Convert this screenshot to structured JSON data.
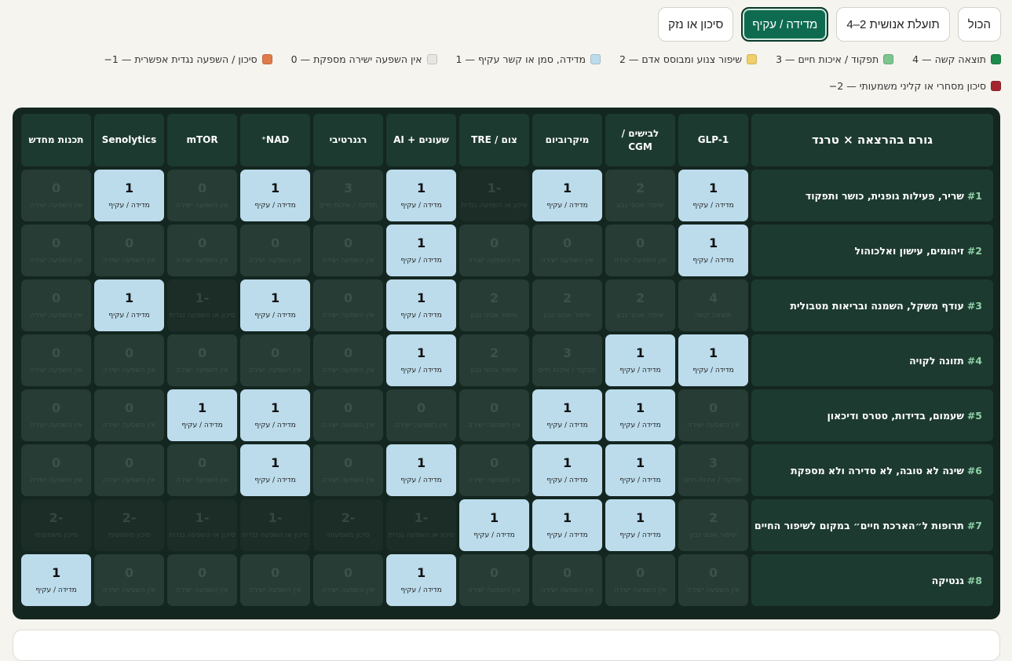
{
  "filters": [
    {
      "label": "הכול",
      "active": false
    },
    {
      "label": "תועלת אנושית 2–4",
      "active": false
    },
    {
      "label": "מדידה / עקיף",
      "active": true
    },
    {
      "label": "סיכון או נזק",
      "active": false
    }
  ],
  "legend": [
    {
      "text": "4 — תוצאה קשה",
      "color": "#1e8a4c"
    },
    {
      "text": "3 — תפקוד / איכות חיים",
      "color": "#7cc58f"
    },
    {
      "text": "2 — שיפור צנוע ומבוסס אדם",
      "color": "#f0cf6a"
    },
    {
      "text": "1 — מדידה, סמן או קשר עקיף",
      "color": "#bcdcec"
    },
    {
      "text": "0 — אין השפעה ישירה מספקת",
      "color": "#e6e6e3"
    },
    {
      "text": "−1 — סיכון / השפעה נגדית אפשרית",
      "color": "#e07a4b"
    },
    {
      "text": "−2 — סיכון מסחרי או קליני משמעותי",
      "color": "#a3262f"
    }
  ],
  "matrix": {
    "corner": "גורם בהרצאה × טרנד",
    "columns": [
      "GLP-1",
      "לבישים / CGM",
      "מיקרוביום",
      "צום / TRE",
      "שעונים + AI",
      "רגנרטיבי",
      "NAD⁺",
      "mTOR",
      "Senolytics",
      "תכנות מחדש"
    ],
    "score_labels": {
      "4": "תוצאה קשה",
      "3": "תפקוד / איכות חיים",
      "2": "שיפור אכוני נבון",
      "1": "מדידה / עקיף",
      "0": "אין השפעה ישירה",
      "-1": "סיכון או השפעה נגדית",
      "-2": "סיכון משמעותי"
    },
    "highlight_score": "1",
    "rows": [
      {
        "num": "#1",
        "label": "שריר, פעילות גופנית, כושר ותפקוד",
        "values": [
          "1",
          "2",
          "1",
          "-1",
          "1",
          "3",
          "1",
          "0",
          "1",
          "0"
        ]
      },
      {
        "num": "#2",
        "label": "זיהומים, עישון ואלכוהול",
        "values": [
          "1",
          "0",
          "0",
          "0",
          "1",
          "0",
          "0",
          "0",
          "0",
          "0"
        ]
      },
      {
        "num": "#3",
        "label": "עודף משקל, השמנה ובריאות מטבולית",
        "values": [
          "4",
          "2",
          "2",
          "2",
          "1",
          "0",
          "1",
          "-1",
          "1",
          "0"
        ]
      },
      {
        "num": "#4",
        "label": "תזונה לקויה",
        "values": [
          "1",
          "1",
          "3",
          "2",
          "1",
          "0",
          "0",
          "0",
          "0",
          "0"
        ]
      },
      {
        "num": "#5",
        "label": "שעמום, בדידות, סטרס ודיכאון",
        "values": [
          "0",
          "1",
          "1",
          "0",
          "0",
          "0",
          "1",
          "1",
          "0",
          "0"
        ]
      },
      {
        "num": "#6",
        "label": "שינה לא טובה, לא סדירה ולא מספקת",
        "values": [
          "3",
          "1",
          "1",
          "0",
          "1",
          "0",
          "1",
          "0",
          "0",
          "0"
        ]
      },
      {
        "num": "#7",
        "label": "תרופות ל״הארכת חיים״ במקום לשיפור החיים",
        "values": [
          "2",
          "1",
          "1",
          "1",
          "-1",
          "-2",
          "-1",
          "-1",
          "-2",
          "-2"
        ]
      },
      {
        "num": "#8",
        "label": "גנטיקה",
        "values": [
          "0",
          "0",
          "0",
          "0",
          "1",
          "0",
          "0",
          "0",
          "0",
          "1"
        ]
      }
    ]
  }
}
